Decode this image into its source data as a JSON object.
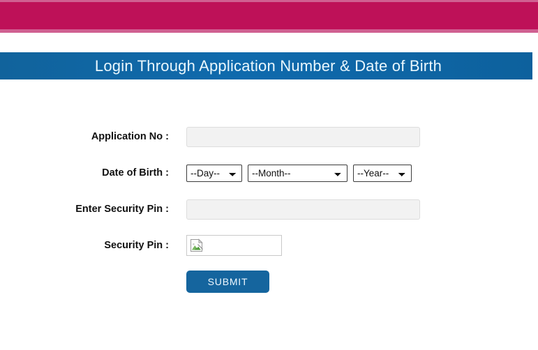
{
  "theme": {
    "band_color": "#be1158",
    "band_edge_color": "#d06091",
    "header_color": "#0d66a5",
    "header_text_color": "#e9f7fd",
    "button_color": "#15659e",
    "label_color": "#111111",
    "input_bg": "#f2f2f2"
  },
  "header": {
    "title": "Login Through Application Number & Date of Birth"
  },
  "form": {
    "rows": [
      {
        "label": "Application No :",
        "type": "text",
        "value": "",
        "placeholder": ""
      },
      {
        "label": "Date of Birth :",
        "type": "date-selects"
      },
      {
        "label": "Enter Security Pin :",
        "type": "text",
        "value": "",
        "placeholder": ""
      },
      {
        "label": "Security Pin :",
        "type": "captcha-image"
      }
    ],
    "day_select": {
      "selected": "--Day--",
      "options": [
        "--Day--"
      ]
    },
    "month_select": {
      "selected": "--Month--",
      "options": [
        "--Month--"
      ]
    },
    "year_select": {
      "selected": "--Year--",
      "options": [
        "--Year--"
      ]
    },
    "captcha": {
      "icon": "broken-image-icon",
      "alt": ""
    },
    "submit_label": "SUBMIT"
  }
}
